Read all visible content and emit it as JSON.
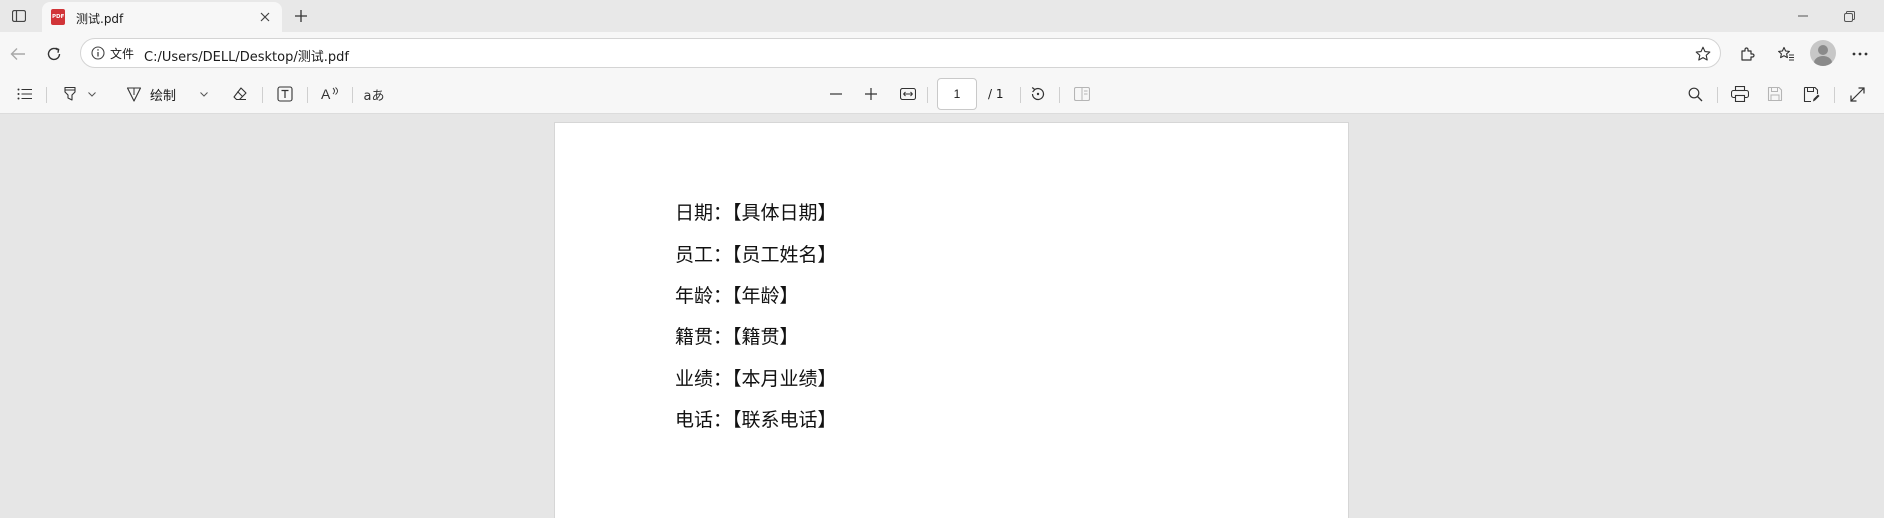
{
  "browser": {
    "tab": {
      "title": "测试.pdf",
      "favicon_text": "PDF"
    },
    "address_bar": {
      "site_info_label": "文件",
      "url": "C:/Users/DELL/Desktop/测试.pdf"
    }
  },
  "pdf_toolbar": {
    "draw_label": "绘制",
    "read_aloud_symbol": "A",
    "translate_label": "aあ",
    "current_page": "1",
    "total_pages": "/ 1"
  },
  "document": {
    "fields": [
      {
        "label": "日期：",
        "value": "【具体日期】"
      },
      {
        "label": "员工：",
        "value": "【员工姓名】"
      },
      {
        "label": "年龄：",
        "value": "【年龄】"
      },
      {
        "label": "籍贯：",
        "value": "【籍贯】"
      },
      {
        "label": "业绩：",
        "value": "【本月业绩】"
      },
      {
        "label": "电话：",
        "value": "【联系电话】"
      }
    ]
  },
  "colors": {
    "pdf_badge": "#d13438",
    "viewer_background": "#e6e6e6",
    "toolbar_background": "#f7f7f7"
  },
  "icons": [
    "tab-actions-icon",
    "pdf-file-icon",
    "close-icon",
    "plus-icon",
    "minimize-icon",
    "restore-icon",
    "back-arrow-icon",
    "refresh-icon",
    "info-icon",
    "star-add-icon",
    "extensions-icon",
    "favorites-icon",
    "more-icon",
    "contents-list-icon",
    "highlighter-icon",
    "draw-pen-icon",
    "eraser-icon",
    "text-box-icon",
    "read-aloud-icon",
    "zoom-out-icon",
    "zoom-in-icon",
    "fit-page-icon",
    "rotate-icon",
    "page-view-icon",
    "search-icon",
    "print-icon",
    "save-icon",
    "save-as-icon",
    "fullscreen-icon"
  ]
}
